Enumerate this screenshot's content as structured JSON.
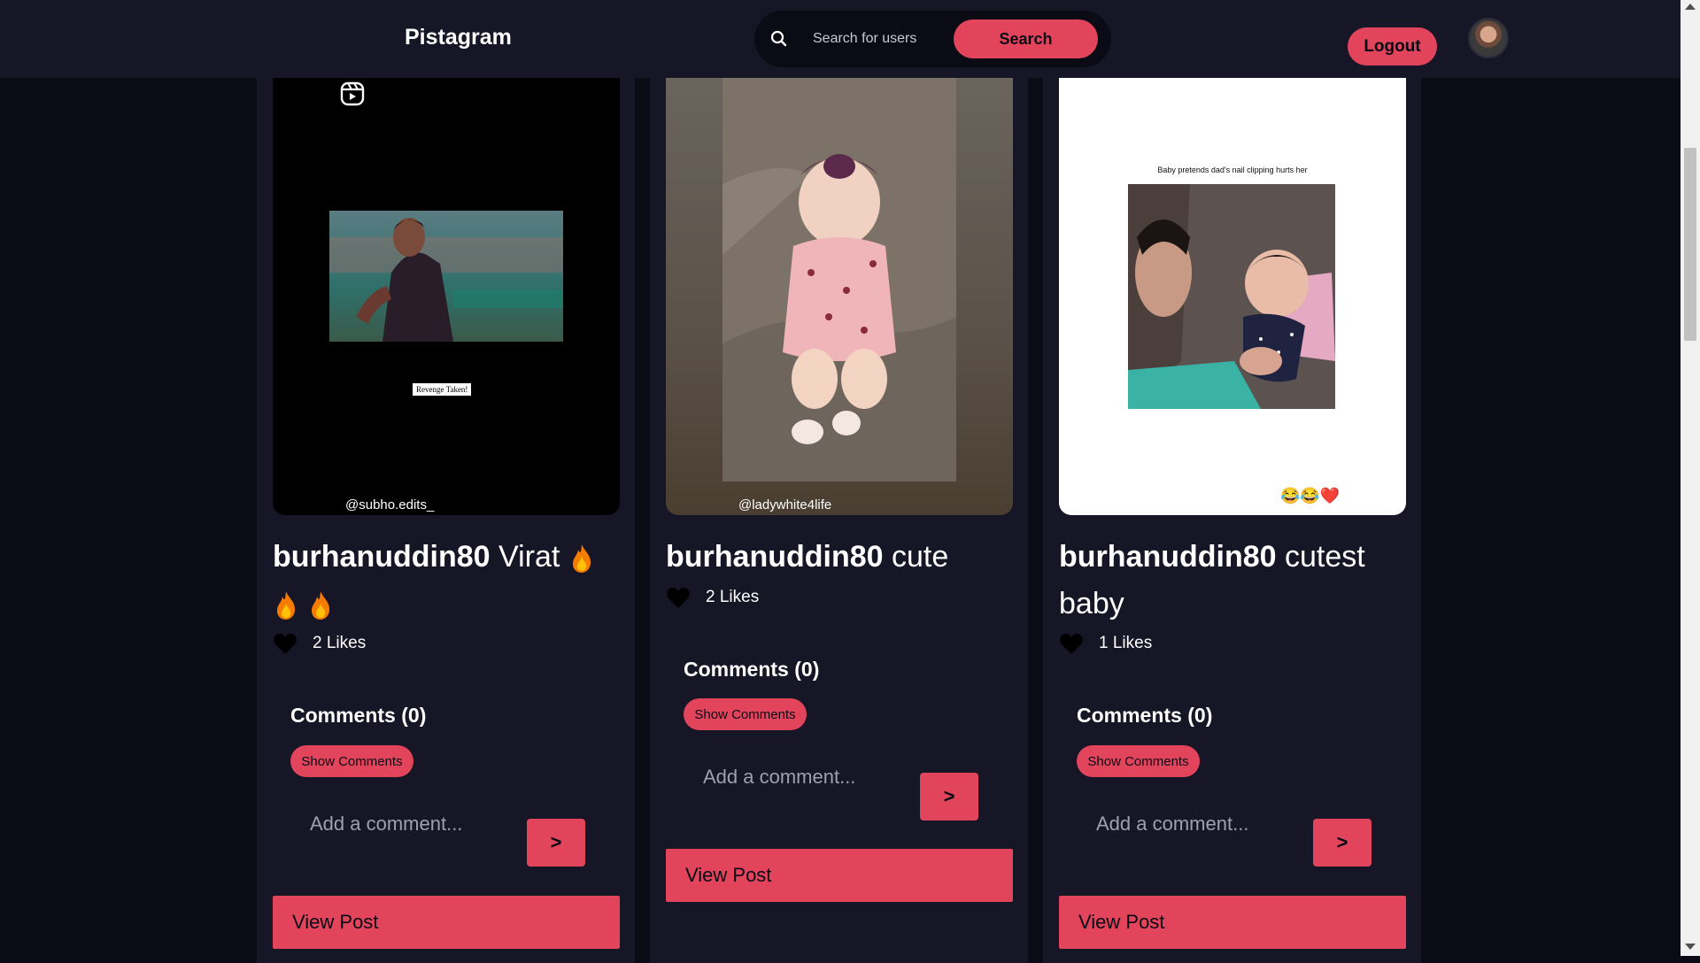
{
  "header": {
    "logo": "Pistagram",
    "search_placeholder": "Search for users",
    "search_button": "Search",
    "logout_button": "Logout"
  },
  "posts": [
    {
      "username": "burhanuddin80",
      "caption": "Virat",
      "caption_emoji": "fire x3",
      "likes": "2 Likes",
      "comments_title": "Comments (0)",
      "show_comments": "Show Comments",
      "comment_placeholder": "Add a comment...",
      "send_label": ">",
      "view_post": "View Post",
      "watermark": "@subho.edits_",
      "overlay_text": "Revenge Taken!"
    },
    {
      "username": "burhanuddin80",
      "caption": "cute",
      "likes": "2 Likes",
      "comments_title": "Comments (0)",
      "show_comments": "Show Comments",
      "comment_placeholder": "Add a comment...",
      "send_label": ">",
      "view_post": "View Post",
      "watermark": "@ladywhite4life"
    },
    {
      "username": "burhanuddin80",
      "caption": "cutest baby",
      "likes": "1 Likes",
      "comments_title": "Comments (0)",
      "show_comments": "Show Comments",
      "comment_placeholder": "Add a comment...",
      "send_label": ">",
      "view_post": "View Post",
      "overlay_text": "Baby pretends dad's nail clipping hurts her",
      "reaction_emojis": "😂😂❤️"
    }
  ],
  "colors": {
    "accent": "#e2445c",
    "background": "#0b0b16",
    "card": "#161627"
  }
}
